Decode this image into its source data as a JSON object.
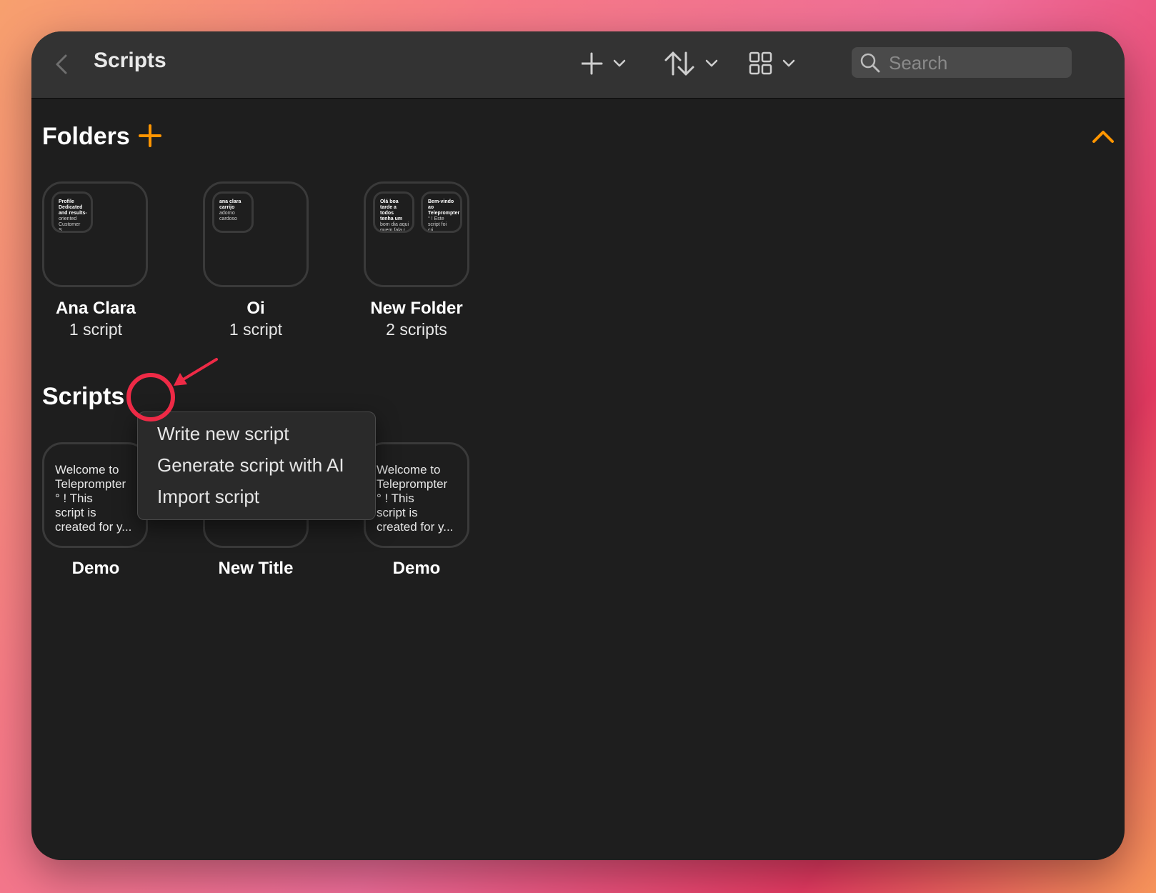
{
  "window": {
    "title": "Scripts",
    "search": {
      "placeholder": "Search",
      "value": ""
    }
  },
  "toolbar_icons": {
    "back": "chevron-left-icon",
    "add": "plus-icon",
    "sort": "sort-arrows-icon",
    "view": "grid-icon",
    "dropdown": "chevron-down-icon",
    "search": "magnifier-icon"
  },
  "folders": {
    "heading": "Folders",
    "items": [
      {
        "name": "Ana Clara",
        "count": "1 script",
        "previews": [
          {
            "title": "Profile\nDedicated\nand results-",
            "body": "oriented\nCustomer S..."
          }
        ]
      },
      {
        "name": "Oi",
        "count": "1 script",
        "previews": [
          {
            "title": "ana clara\ncarrijo",
            "body": "adorno\ncardoso"
          }
        ]
      },
      {
        "name": "New Folder",
        "count": "2 scripts",
        "previews": [
          {
            "title": "Olá boa\ntarde a todos\ntenha um",
            "body": "bom dia aqui\nquem fala r..."
          },
          {
            "title": "Bem-vindo\nao\nTeleprompter",
            "body": "° !  Este\nscript foi cri..."
          }
        ]
      }
    ]
  },
  "scripts": {
    "heading": "Scripts",
    "items": [
      {
        "title": "Demo",
        "preview": "Welcome to\nTeleprompter\n° !  This\nscript is\ncreated for y..."
      },
      {
        "title": "New Title",
        "preview": ""
      },
      {
        "title": "Demo",
        "preview": "Welcome to\nTeleprompter\n° !  This\nscript is\ncreated for y..."
      }
    ]
  },
  "menu": {
    "items": [
      "Write new script",
      "Generate script with AI",
      "Import script"
    ]
  },
  "colors": {
    "accent": "#ff9500",
    "highlight": "#ee2a46",
    "window_bg": "#1e1e1e",
    "toolbar_bg": "#333333"
  }
}
